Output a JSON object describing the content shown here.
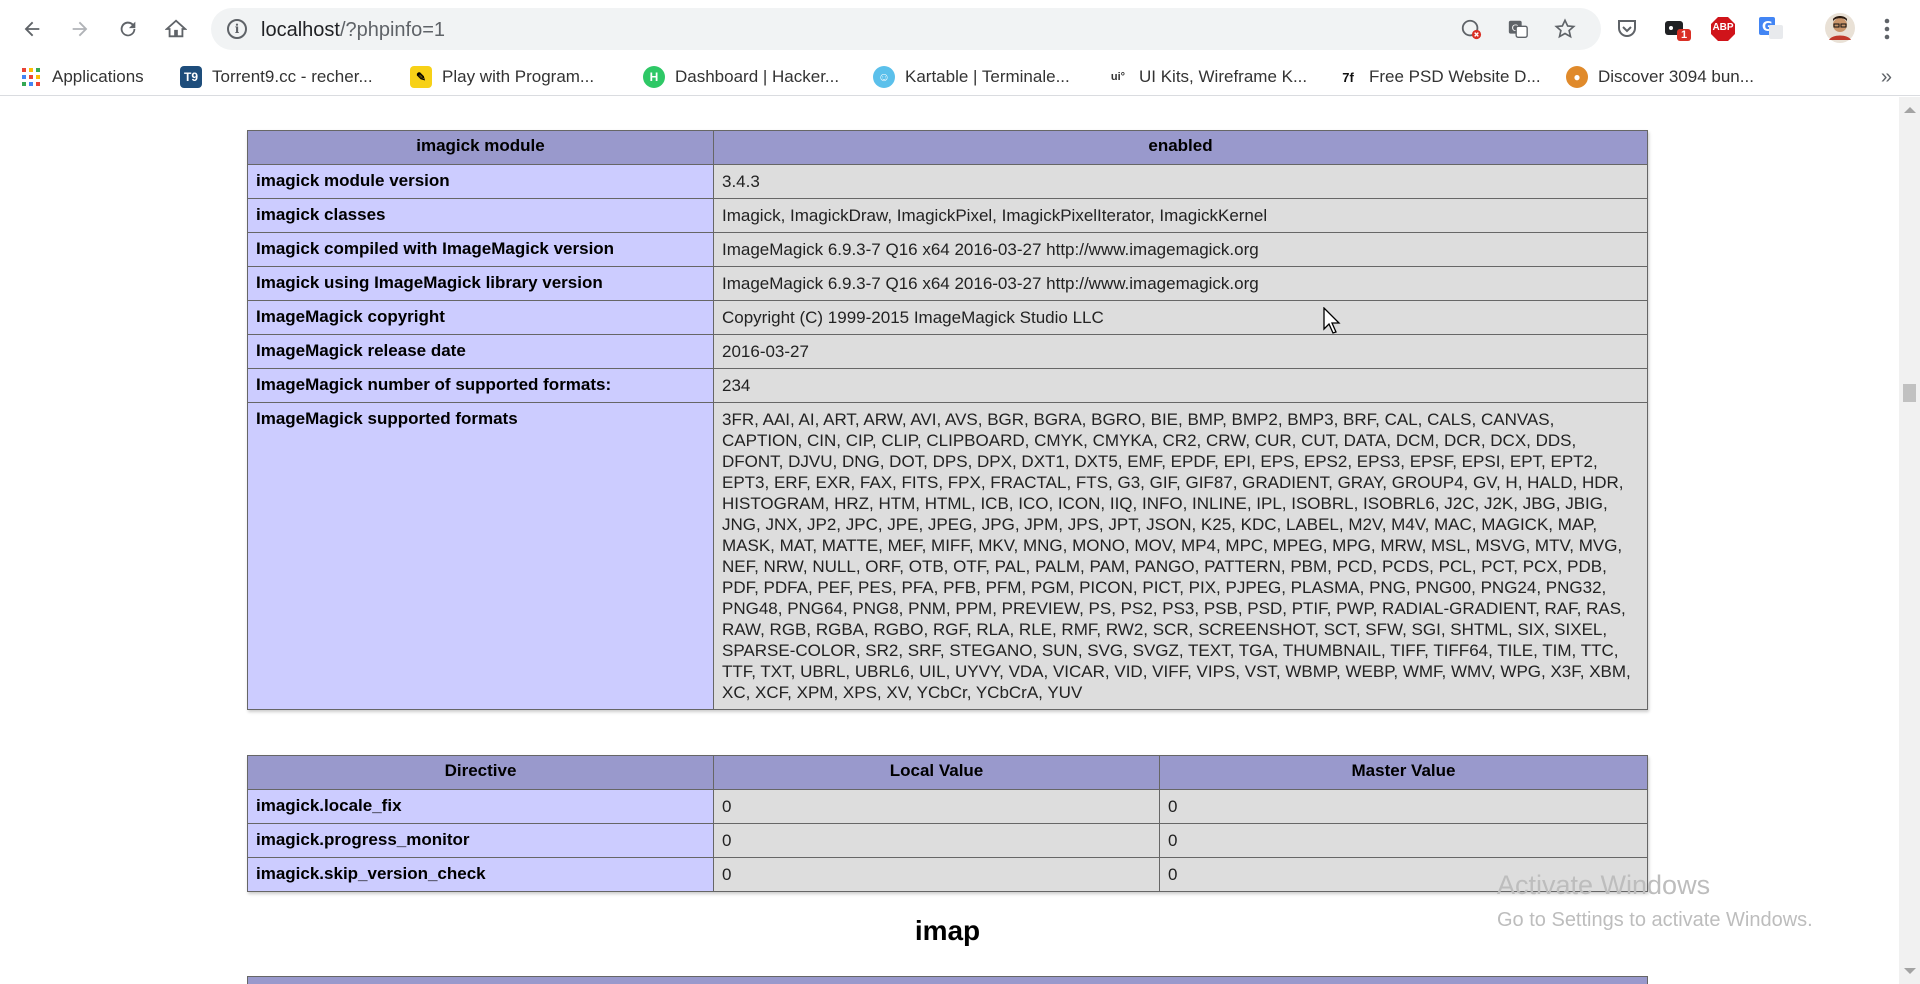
{
  "browser": {
    "url_host": "localhost",
    "url_path": "/?phpinfo=1",
    "bookmarks": [
      {
        "label": "Applications",
        "icon": "apps-grid-icon"
      },
      {
        "label": "Torrent9.cc - recher...",
        "icon": "torrent9-icon"
      },
      {
        "label": "Play with Program...",
        "icon": "pencil-icon"
      },
      {
        "label": "Dashboard | Hacker...",
        "icon": "hackerrank-icon"
      },
      {
        "label": "Kartable | Terminale...",
        "icon": "kartable-icon"
      },
      {
        "label": "UI Kits, Wireframe K...",
        "icon": "uikits-icon"
      },
      {
        "label": "Free PSD Website D...",
        "icon": "psd-icon"
      },
      {
        "label": "Discover 3094 bun...",
        "icon": "cookie-icon"
      }
    ],
    "extension_badge": "1",
    "abp_label": "ABP",
    "more_label": "»"
  },
  "imagick_table": {
    "header": [
      "imagick module",
      "enabled"
    ],
    "rows": [
      [
        "imagick module version",
        "3.4.3"
      ],
      [
        "imagick classes",
        "Imagick, ImagickDraw, ImagickPixel, ImagickPixelIterator, ImagickKernel"
      ],
      [
        "Imagick compiled with ImageMagick version",
        "ImageMagick 6.9.3-7 Q16 x64 2016-03-27 http://www.imagemagick.org"
      ],
      [
        "Imagick using ImageMagick library version",
        "ImageMagick 6.9.3-7 Q16 x64 2016-03-27 http://www.imagemagick.org"
      ],
      [
        "ImageMagick copyright",
        "Copyright (C) 1999-2015 ImageMagick Studio LLC"
      ],
      [
        "ImageMagick release date",
        "2016-03-27"
      ],
      [
        "ImageMagick number of supported formats:",
        "234"
      ],
      [
        "ImageMagick supported formats",
        "3FR, AAI, AI, ART, ARW, AVI, AVS, BGR, BGRA, BGRO, BIE, BMP, BMP2, BMP3, BRF, CAL, CALS, CANVAS, CAPTION, CIN, CIP, CLIP, CLIPBOARD, CMYK, CMYKA, CR2, CRW, CUR, CUT, DATA, DCM, DCR, DCX, DDS, DFONT, DJVU, DNG, DOT, DPS, DPX, DXT1, DXT5, EMF, EPDF, EPI, EPS, EPS2, EPS3, EPSF, EPSI, EPT, EPT2, EPT3, ERF, EXR, FAX, FITS, FPX, FRACTAL, FTS, G3, GIF, GIF87, GRADIENT, GRAY, GROUP4, GV, H, HALD, HDR, HISTOGRAM, HRZ, HTM, HTML, ICB, ICO, ICON, IIQ, INFO, INLINE, IPL, ISOBRL, ISOBRL6, J2C, J2K, JBG, JBIG, JNG, JNX, JP2, JPC, JPE, JPEG, JPG, JPM, JPS, JPT, JSON, K25, KDC, LABEL, M2V, M4V, MAC, MAGICK, MAP, MASK, MAT, MATTE, MEF, MIFF, MKV, MNG, MONO, MOV, MP4, MPC, MPEG, MPG, MRW, MSL, MSVG, MTV, MVG, NEF, NRW, NULL, ORF, OTB, OTF, PAL, PALM, PAM, PANGO, PATTERN, PBM, PCD, PCDS, PCL, PCT, PCX, PDB, PDF, PDFA, PEF, PES, PFA, PFB, PFM, PGM, PICON, PICT, PIX, PJPEG, PLASMA, PNG, PNG00, PNG24, PNG32, PNG48, PNG64, PNG8, PNM, PPM, PREVIEW, PS, PS2, PS3, PSB, PSD, PTIF, PWP, RADIAL-GRADIENT, RAF, RAS, RAW, RGB, RGBA, RGBO, RGF, RLA, RLE, RMF, RW2, SCR, SCREENSHOT, SCT, SFW, SGI, SHTML, SIX, SIXEL, SPARSE-COLOR, SR2, SRF, STEGANO, SUN, SVG, SVGZ, TEXT, TGA, THUMBNAIL, TIFF, TIFF64, TILE, TIM, TTC, TTF, TXT, UBRL, UBRL6, UIL, UYVY, VDA, VICAR, VID, VIFF, VIPS, VST, WBMP, WEBP, WMF, WMV, WPG, X3F, XBM, XC, XCF, XPM, XPS, XV, YCbCr, YCbCrA, YUV"
      ]
    ]
  },
  "directive_table": {
    "header": [
      "Directive",
      "Local Value",
      "Master Value"
    ],
    "rows": [
      [
        "imagick.locale_fix",
        "0",
        "0"
      ],
      [
        "imagick.progress_monitor",
        "0",
        "0"
      ],
      [
        "imagick.skip_version_check",
        "0",
        "0"
      ]
    ]
  },
  "next_section_title": "imap",
  "watermark": {
    "line1": "Activate Windows",
    "line2": "Go to Settings to activate Windows."
  }
}
